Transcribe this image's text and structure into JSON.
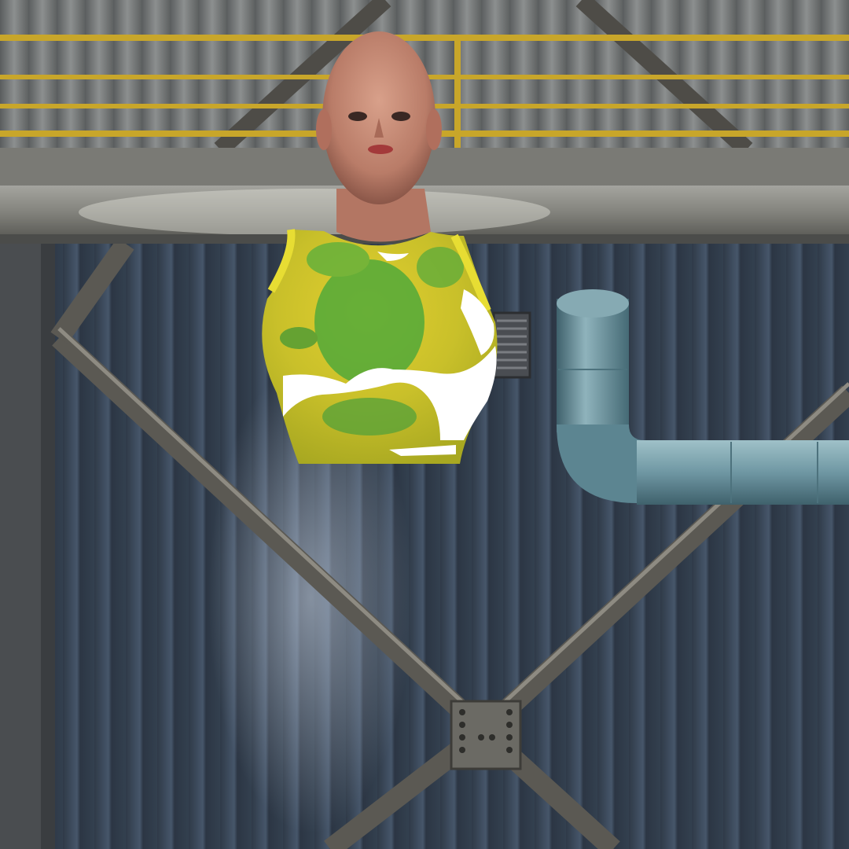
{
  "scene": {
    "colors": {
      "wall_panel": "#3b4858",
      "wall_highlight": "#7f8fa4",
      "upper_wall": "#6f7170",
      "rail_gold": "#c8a62a",
      "beam_concrete": "#8a8a86",
      "steel_brace": "#5b5953",
      "pipe": "#6f97a3",
      "shirt_yellow": "#d9c42a",
      "shirt_green": "#4aa83a",
      "skin": "#c98d78"
    },
    "icons": [
      "vent-grille",
      "bolted-plate",
      "duct-pipe",
      "guard-railing"
    ]
  }
}
